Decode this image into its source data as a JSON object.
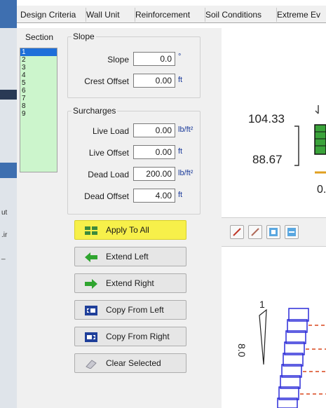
{
  "tabs": [
    "Design Criteria",
    "Wall Unit",
    "Reinforcement",
    "Soil Conditions",
    "Extreme Ev"
  ],
  "section": {
    "header": "Section",
    "items": [
      "1",
      "2",
      "3",
      "4",
      "5",
      "6",
      "7",
      "8",
      "9"
    ],
    "selected_index": 0
  },
  "slope_group": {
    "title": "Slope",
    "fields": [
      {
        "label": "Slope",
        "value": "0.0",
        "unit": "°"
      },
      {
        "label": "Crest Offset",
        "value": "0.00",
        "unit": "ft"
      }
    ]
  },
  "surcharges_group": {
    "title": "Surcharges",
    "fields": [
      {
        "label": "Live Load",
        "value": "0.00",
        "unit": "lb/ft²"
      },
      {
        "label": "Live Offset",
        "value": "0.00",
        "unit": "ft"
      },
      {
        "label": "Dead Load",
        "value": "200.00",
        "unit": "lb/ft²"
      },
      {
        "label": "Dead Offset",
        "value": "4.00",
        "unit": "ft"
      }
    ]
  },
  "buttons": [
    {
      "label": "Apply To All",
      "icon": "apply-all-icon",
      "highlighted": true
    },
    {
      "label": "Extend Left",
      "icon": "arrow-left-icon"
    },
    {
      "label": "Extend Right",
      "icon": "arrow-right-icon"
    },
    {
      "label": "Copy From Left",
      "icon": "copy-left-icon"
    },
    {
      "label": "Copy From Right",
      "icon": "copy-right-icon"
    },
    {
      "label": "Clear Selected",
      "icon": "eraser-icon"
    }
  ],
  "preview": {
    "top_elevation": "104.33",
    "bottom_elevation": "88.67",
    "partial_label": "0.",
    "batter_rise": "1",
    "batter_run": "8.0"
  },
  "colors": {
    "accent_blue": "#1e6fd9",
    "highlight_yellow": "#f7f04a",
    "section_green": "#ccf5cc",
    "block_blue": "#2b2bd8",
    "reinforcement_orange": "#d8461b"
  }
}
